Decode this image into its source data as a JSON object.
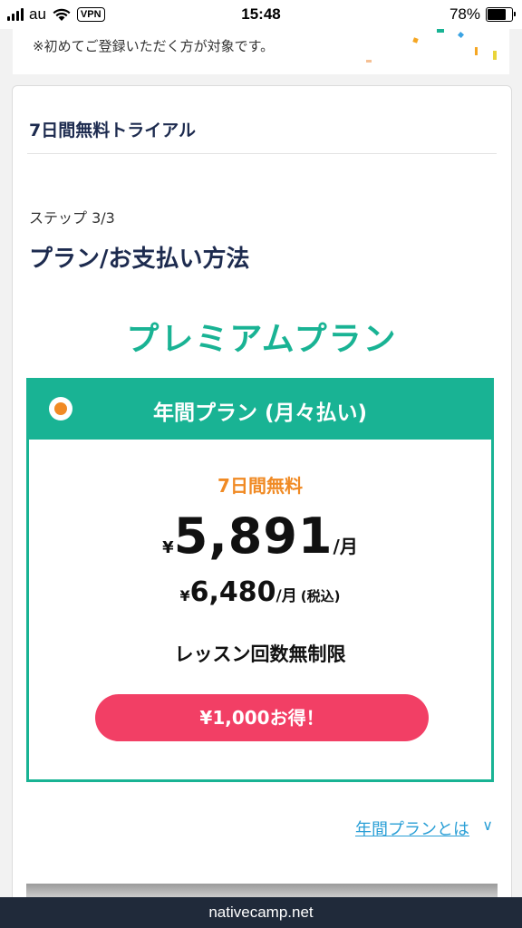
{
  "status_bar": {
    "carrier": "au",
    "vpn": "VPN",
    "time": "15:48",
    "battery": "78%",
    "battery_level": 0.78
  },
  "top_note": "※初めてご登録いただく方が対象です。",
  "card": {
    "title": "7日間無料トライアル",
    "step": "ステップ 3/3",
    "section_title": "プラン/お支払い方法",
    "plan_name": "プレミアムプラン"
  },
  "plan": {
    "header": "年間プラン (月々払い)",
    "free_label": "7日間無料",
    "yen_symbol": "¥",
    "price": "5,891",
    "price_unit": "/月",
    "tax_price": "6,480",
    "tax_unit": "/月",
    "tax_note": "(税込)",
    "lessons": "レッスン回数無制限",
    "save_label": "¥1,000お得！",
    "selected": true
  },
  "about_link": "年間プランとは",
  "about_chevron": "∨",
  "url": "nativecamp.net",
  "colors": {
    "accent": "#19b394",
    "orange": "#f08a24",
    "cta": "#f23f65",
    "link": "#2a9fd6",
    "navy": "#1d2b4f"
  }
}
